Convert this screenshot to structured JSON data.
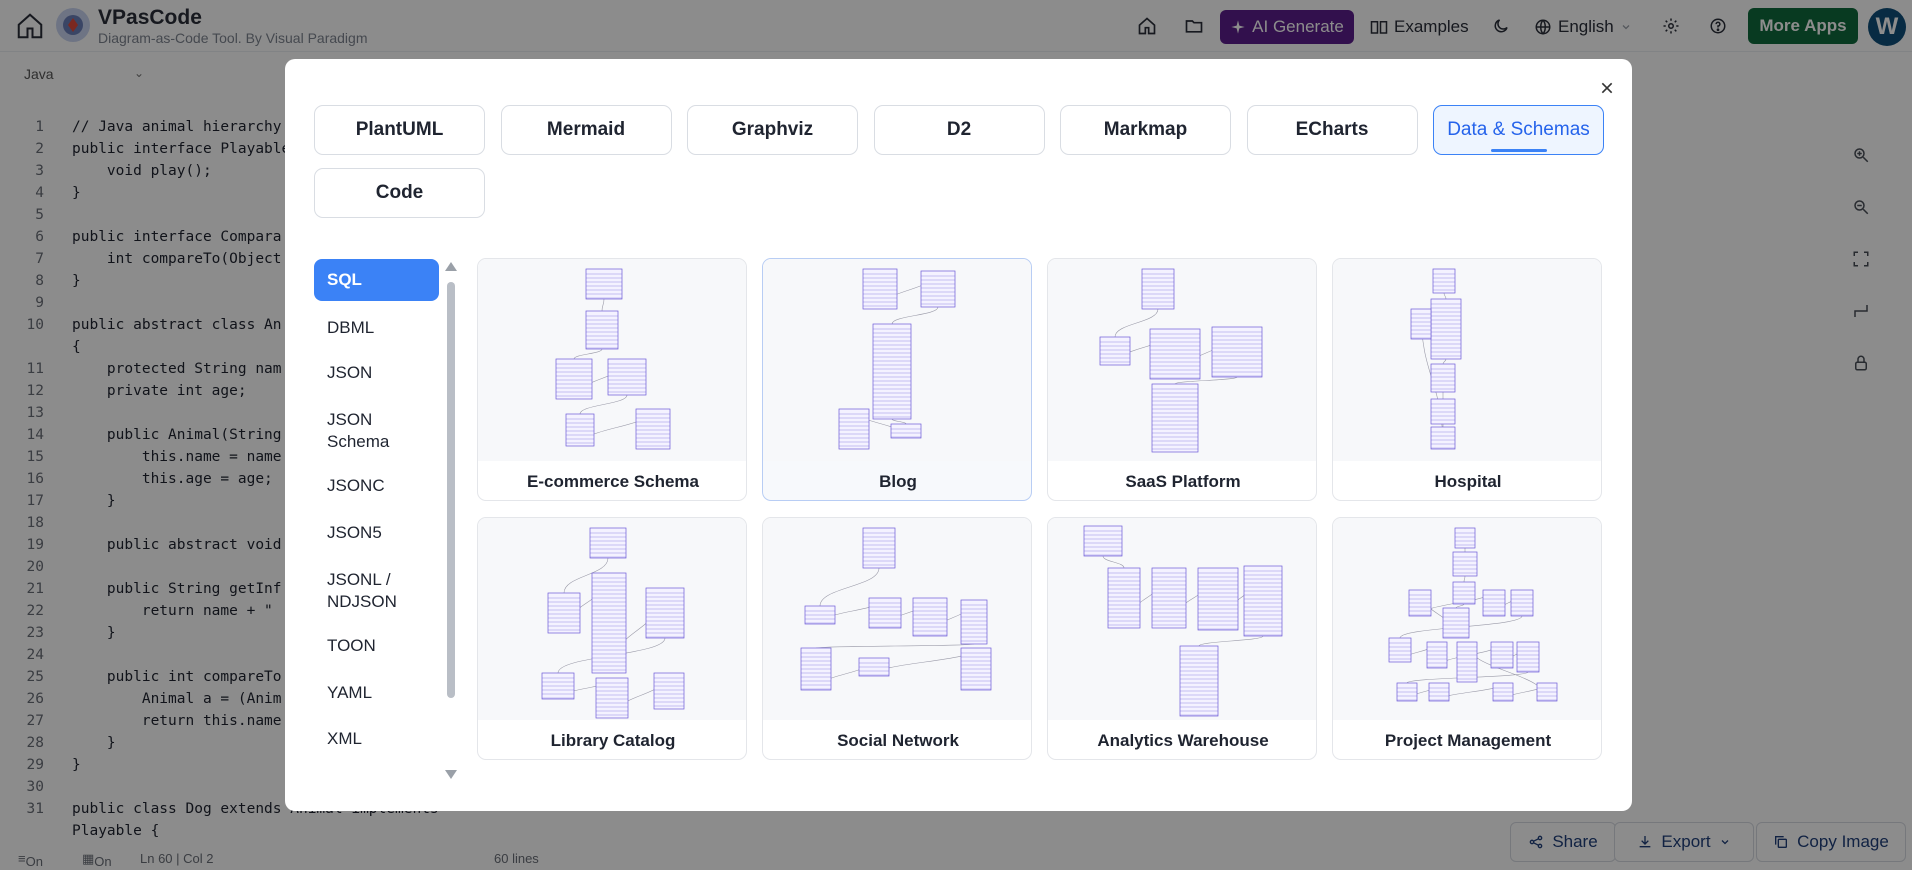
{
  "header": {
    "app_title": "VPasCode",
    "app_subtitle": "Diagram-as-Code Tool. By Visual Paradigm",
    "ai_generate": "AI Generate",
    "examples": "Examples",
    "language": "English",
    "more_apps": "More Apps",
    "avatar_initial": "W"
  },
  "editor": {
    "language": "Java",
    "lines": [
      {
        "n": "1",
        "t": "// Java animal hierarchy"
      },
      {
        "n": "2",
        "t": "public interface Playable"
      },
      {
        "n": "3",
        "t": "    void play();"
      },
      {
        "n": "4",
        "t": "}"
      },
      {
        "n": "5",
        "t": ""
      },
      {
        "n": "6",
        "t": "public interface Compara"
      },
      {
        "n": "7",
        "t": "    int compareTo(Object"
      },
      {
        "n": "8",
        "t": "}"
      },
      {
        "n": "9",
        "t": ""
      },
      {
        "n": "10",
        "t": "public abstract class An"
      },
      {
        "n": "",
        "t": "{"
      },
      {
        "n": "11",
        "t": "    protected String nam"
      },
      {
        "n": "12",
        "t": "    private int age;"
      },
      {
        "n": "13",
        "t": ""
      },
      {
        "n": "14",
        "t": "    public Animal(String"
      },
      {
        "n": "15",
        "t": "        this.name = name"
      },
      {
        "n": "16",
        "t": "        this.age = age;"
      },
      {
        "n": "17",
        "t": "    }"
      },
      {
        "n": "18",
        "t": ""
      },
      {
        "n": "19",
        "t": "    public abstract void"
      },
      {
        "n": "20",
        "t": ""
      },
      {
        "n": "21",
        "t": "    public String getInf"
      },
      {
        "n": "22",
        "t": "        return name + \""
      },
      {
        "n": "23",
        "t": "    }"
      },
      {
        "n": "24",
        "t": ""
      },
      {
        "n": "25",
        "t": "    public int compareTo"
      },
      {
        "n": "26",
        "t": "        Animal a = (Anim"
      },
      {
        "n": "27",
        "t": "        return this.name"
      },
      {
        "n": "28",
        "t": "    }"
      },
      {
        "n": "29",
        "t": "}"
      },
      {
        "n": "30",
        "t": ""
      },
      {
        "n": "31",
        "t": "public class Dog extends Animal implements"
      },
      {
        "n": "",
        "t": "Playable {"
      }
    ],
    "status": {
      "wrap": "On",
      "minimap": "On",
      "position": "Ln 60 | Col 2",
      "line_count": "60 lines"
    }
  },
  "bottom_actions": {
    "share": "Share",
    "export": "Export",
    "copy_image": "Copy Image"
  },
  "modal": {
    "tabs": [
      "PlantUML",
      "Mermaid",
      "Graphviz",
      "D2",
      "Markmap",
      "ECharts",
      "Data & Schemas",
      "Code"
    ],
    "active_tab": "Data & Schemas",
    "categories": [
      "SQL",
      "DBML",
      "JSON",
      "JSON Schema",
      "JSONC",
      "JSON5",
      "JSONL / NDJSON",
      "TOON",
      "YAML",
      "XML"
    ],
    "active_category": "SQL",
    "templates": [
      "E-commerce Schema",
      "Blog",
      "SaaS Platform",
      "Hospital",
      "Library Catalog",
      "Social Network",
      "Analytics Warehouse",
      "Project Management"
    ],
    "hovered_template": "Blog"
  },
  "colors": {
    "ai_generate_bg": "#5b1e8c",
    "more_apps_bg": "#0f6b3c",
    "avatar_bg": "#0f4f7a",
    "accent": "#3b82f6",
    "schema_lines": "#6b5bd6"
  },
  "icons": [
    "home-icon",
    "logo-icon",
    "folder-icon",
    "sparkle-icon",
    "book-icon",
    "moon-icon",
    "globe-icon",
    "gear-icon",
    "help-icon",
    "close-icon",
    "zoom-in-icon",
    "zoom-out-icon",
    "fit-icon",
    "route-icon",
    "lock-icon",
    "share-icon",
    "export-icon",
    "copy-icon"
  ]
}
